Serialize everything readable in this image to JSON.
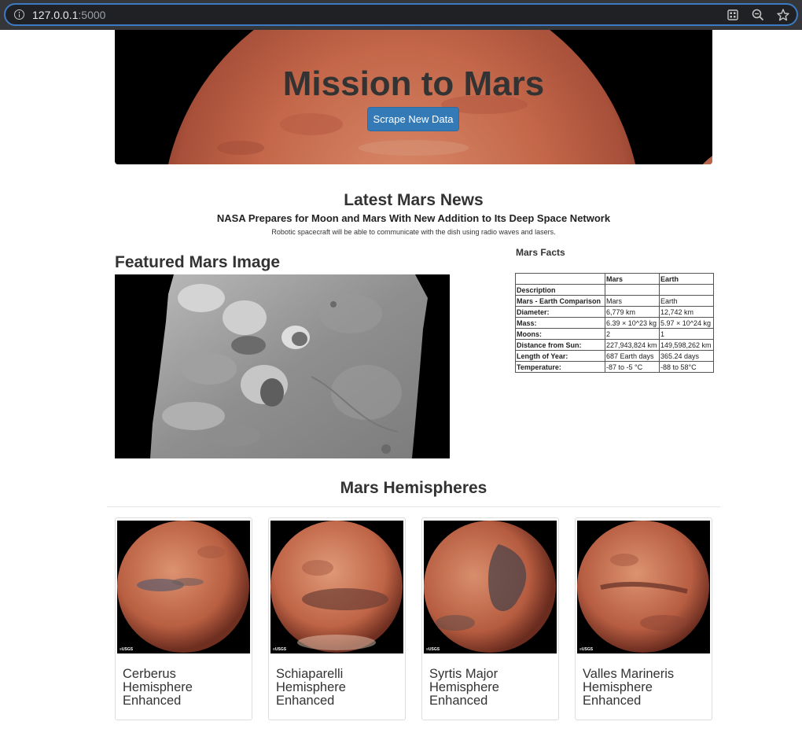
{
  "browser": {
    "url_host": "127.0.0.1",
    "url_port": ":5000"
  },
  "hero": {
    "title": "Mission to Mars",
    "scrape_button": "Scrape New Data"
  },
  "news": {
    "section_title": "Latest Mars News",
    "headline": "NASA Prepares for Moon and Mars With New Addition to Its Deep Space Network",
    "teaser": "Robotic spacecraft will be able to communicate with the dish using radio waves and lasers."
  },
  "featured": {
    "title": "Featured Mars Image"
  },
  "facts": {
    "title": "Mars Facts",
    "columns": [
      "",
      "Mars",
      "Earth"
    ],
    "rows": [
      [
        "Description",
        "",
        ""
      ],
      [
        "Mars - Earth Comparison",
        "Mars",
        "Earth"
      ],
      [
        "Diameter:",
        "6,779 km",
        "12,742 km"
      ],
      [
        "Mass:",
        "6.39 × 10^23 kg",
        "5.97 × 10^24 kg"
      ],
      [
        "Moons:",
        "2",
        "1"
      ],
      [
        "Distance from Sun:",
        "227,943,824 km",
        "149,598,262 km"
      ],
      [
        "Length of Year:",
        "687 Earth days",
        "365.24 days"
      ],
      [
        "Temperature:",
        "-87 to -5 °C",
        "-88 to 58°C"
      ]
    ]
  },
  "hemispheres": {
    "title": "Mars Hemispheres",
    "items": [
      {
        "title": "Cerberus Hemisphere Enhanced"
      },
      {
        "title": "Schiaparelli Hemisphere Enhanced"
      },
      {
        "title": "Syrtis Major Hemisphere Enhanced"
      },
      {
        "title": "Valles Marineris Hemisphere Enhanced"
      }
    ]
  },
  "colors": {
    "button_primary": "#337ab7",
    "browser_chrome": "#35363a",
    "address_focus": "#3c7bc4",
    "mars_surface": "#c4674a"
  },
  "icons": [
    "info-icon",
    "grid-icon",
    "zoom-out-icon",
    "star-icon"
  ]
}
